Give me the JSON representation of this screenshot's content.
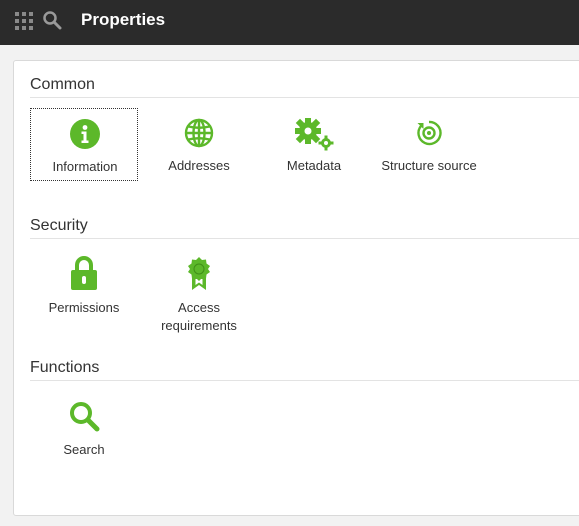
{
  "header": {
    "title": "Properties",
    "apps_icon": "apps-grid-icon",
    "search_icon": "search-icon"
  },
  "colors": {
    "accent": "#5cb82a",
    "topbar": "#2b2b2b",
    "background": "#f2f2f2"
  },
  "sections": [
    {
      "title": "Common",
      "items": [
        {
          "label": "Information",
          "icon": "info-icon",
          "selected": true
        },
        {
          "label": "Addresses",
          "icon": "globe-icon"
        },
        {
          "label": "Metadata",
          "icon": "gears-icon"
        },
        {
          "label": "Structure source",
          "icon": "target-refresh-icon"
        }
      ]
    },
    {
      "title": "Security",
      "items": [
        {
          "label": "Permissions",
          "icon": "lock-icon"
        },
        {
          "label": "Access requirements",
          "label_line1": "Access",
          "label_line2": "requirements",
          "icon": "award-ribbon-icon"
        }
      ]
    },
    {
      "title": "Functions",
      "items": [
        {
          "label": "Search",
          "icon": "search-icon"
        }
      ]
    }
  ]
}
